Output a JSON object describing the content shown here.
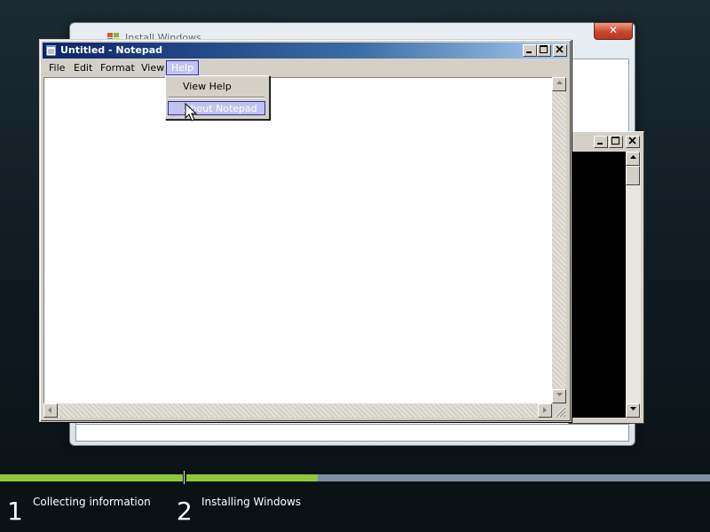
{
  "setup_window": {
    "title": "Install Windows",
    "close_glyph": "✕"
  },
  "console_window": {
    "buttons": [
      "minimize",
      "maximize",
      "close"
    ]
  },
  "notepad": {
    "title": "Untitled - Notepad",
    "menu": [
      "File",
      "Edit",
      "Format",
      "View",
      "Help"
    ],
    "active_menu": "Help",
    "content": ""
  },
  "help_menu": {
    "items": [
      "View Help",
      "About Notepad"
    ],
    "highlighted": "About Notepad"
  },
  "progress": {
    "steps": [
      {
        "number": "1",
        "label": "Collecting information",
        "fraction_complete": 1.0
      },
      {
        "number": "2",
        "label": "Installing Windows",
        "fraction_complete": 0.25
      }
    ]
  },
  "colors": {
    "progress_fill": "#92c53c",
    "progress_track": "#7f8ea0",
    "menu_highlight": "#c2c2f0",
    "notepad_title_start": "#0a246a"
  },
  "icons": [
    "windows-logo-icon",
    "notepad-icon",
    "minimize-icon",
    "maximize-icon",
    "close-icon",
    "scroll-up-icon",
    "scroll-down-icon",
    "scroll-left-icon",
    "scroll-right-icon",
    "size-grip-icon",
    "mouse-pointer-icon"
  ]
}
